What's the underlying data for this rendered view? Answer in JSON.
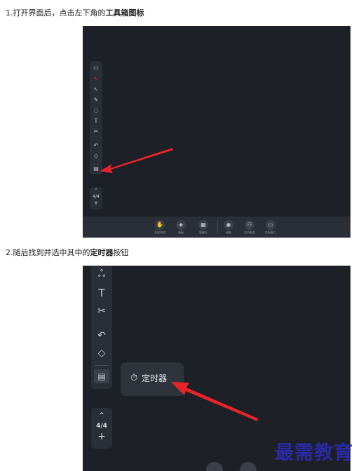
{
  "steps": [
    {
      "prefix": "1.打开界面后，点击左下角的",
      "emphasis": "工具箱图标"
    },
    {
      "prefix": "2.随后找到并选中其中的",
      "emphasis": "定时器",
      "suffix": "按钮"
    }
  ],
  "screenshot1": {
    "toolbar_icons": [
      "note-icon",
      "pointer-red-icon",
      "select-icon",
      "pen-icon",
      "shapes-icon",
      "text-icon",
      "scissors-icon",
      "undo-icon",
      "eraser-icon",
      "toolbox-icon"
    ],
    "page_indicator": "4/4",
    "bottom_items": [
      {
        "icon": "hand-icon",
        "label": "全屏浏览"
      },
      {
        "icon": "shield-icon",
        "label": "画板"
      },
      {
        "icon": "grid-icon",
        "label": "管理卡"
      },
      {
        "icon": "record-icon",
        "label": "录制"
      },
      {
        "icon": "people-icon",
        "label": "全员参会"
      },
      {
        "icon": "monitor-icon",
        "label": "共享窗口"
      }
    ]
  },
  "screenshot2": {
    "page_indicator": "4/4",
    "popup_label": "定时器"
  },
  "watermark": "最需教育",
  "colors": {
    "background": "#1d2127",
    "toolbar": "#2a2e36",
    "arrow": "#e8232a",
    "watermark": "#2a2aa8"
  }
}
